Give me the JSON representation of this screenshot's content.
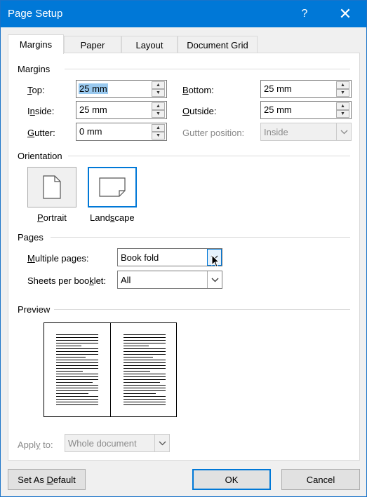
{
  "window": {
    "title": "Page Setup",
    "help_label": "?",
    "close_label": "✕"
  },
  "tabs": [
    {
      "label": "Margins",
      "active": true
    },
    {
      "label": "Paper",
      "active": false
    },
    {
      "label": "Layout",
      "active": false
    },
    {
      "label": "Document Grid",
      "active": false
    }
  ],
  "margins": {
    "group_label": "Margins",
    "top": {
      "label_u": "T",
      "label_rest": "op:",
      "value": "25 mm"
    },
    "bottom": {
      "label_u": "B",
      "label_rest": "ottom:",
      "value": "25 mm"
    },
    "inside": {
      "label_pre": "I",
      "label_u": "n",
      "label_rest": "side:",
      "value": "25 mm"
    },
    "outside": {
      "label_u": "O",
      "label_rest": "utside:",
      "value": "25 mm"
    },
    "gutter": {
      "label_u": "G",
      "label_rest": "utter:",
      "value": "0 mm"
    },
    "gutter_position": {
      "label": "Gutter position:",
      "value": "Inside"
    }
  },
  "orientation": {
    "group_label": "Orientation",
    "portrait": {
      "label_u": "P",
      "label_rest": "ortrait"
    },
    "landscape": {
      "label_pre": "Land",
      "label_u": "s",
      "label_rest": "cape"
    }
  },
  "pages": {
    "group_label": "Pages",
    "multiple_pages": {
      "label_u": "M",
      "label_rest": "ultiple pages:",
      "value": "Book fold"
    },
    "sheets_per_booklet": {
      "label_pre": "Sheets per boo",
      "label_u": "k",
      "label_rest": "let:",
      "value": "All"
    }
  },
  "preview": {
    "group_label": "Preview"
  },
  "apply_to": {
    "label_pre": "Appl",
    "label_u": "y",
    "label_rest": " to:",
    "value": "Whole document"
  },
  "buttons": {
    "set_default": {
      "label_pre": "Set As ",
      "label_u": "D",
      "label_rest": "efault"
    },
    "ok": "OK",
    "cancel": "Cancel"
  },
  "icons": {
    "help": "help-icon",
    "close": "close-icon",
    "spin_up": "spin-up-arrow-icon",
    "spin_down": "spin-down-arrow-icon",
    "dropdown": "chevron-down-icon",
    "portrait": "portrait-page-icon",
    "landscape": "landscape-page-icon",
    "cursor": "mouse-pointer-icon"
  },
  "colors": {
    "title_bar": "#0078d7",
    "accent": "#0078d7",
    "selection": "#99c9ef"
  }
}
